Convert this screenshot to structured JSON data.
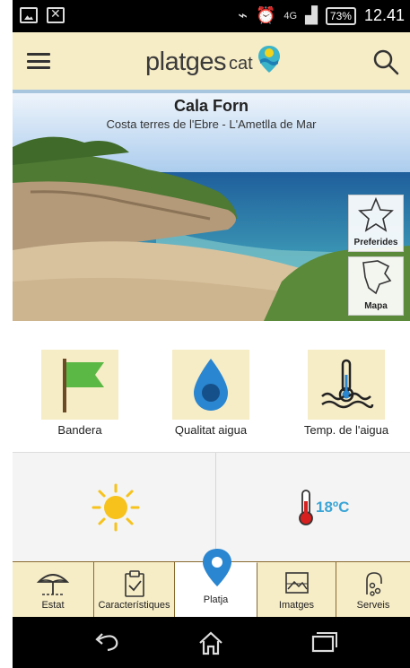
{
  "status_bar": {
    "network": "4G",
    "battery": "73%",
    "time": "12.41"
  },
  "app": {
    "logo_main": "platges",
    "logo_sub": "cat"
  },
  "beach": {
    "name": "Cala Forn",
    "location": "Costa terres de l'Ebre - L'Ametlla de Mar"
  },
  "side_actions": {
    "favorites": "Preferides",
    "map": "Mapa"
  },
  "indicators": [
    {
      "label": "Bandera",
      "icon": "flag-icon",
      "color": "#5cb845"
    },
    {
      "label": "Qualitat aigua",
      "icon": "water-drop-icon",
      "color": "#2a86d0"
    },
    {
      "label": "Temp. de l'aigua",
      "icon": "water-temperature-icon",
      "color": "#222222"
    }
  ],
  "weather": {
    "condition_icon": "sun-icon",
    "temperature": "18ºC"
  },
  "tabs": [
    {
      "label": "Estat",
      "icon": "umbrella-icon"
    },
    {
      "label": "Característiques",
      "icon": "clipboard-check-icon"
    },
    {
      "label": "Platja",
      "icon": "location-pin-icon",
      "active": true
    },
    {
      "label": "Imatges",
      "icon": "image-icon"
    },
    {
      "label": "Serveis",
      "icon": "services-icon"
    }
  ],
  "colors": {
    "header_bg": "#f6ecc6",
    "accent_blue": "#3aa5d6",
    "pin_blue": "#2a86d0",
    "flag_green": "#5cb845"
  }
}
